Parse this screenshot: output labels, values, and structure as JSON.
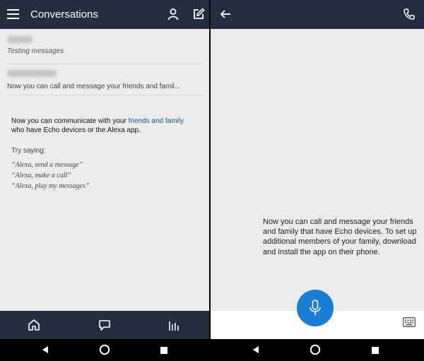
{
  "left": {
    "header": {
      "title": "Conversations"
    },
    "conversations": [
      {
        "subtitle": "Testing messages"
      },
      {
        "subtitle": "Now you can call and message your friends and famil..."
      }
    ],
    "info": {
      "line_start": "Now you can communicate with your ",
      "link": "friends and family",
      "line_end": "who have Echo devices or the Alexa app."
    },
    "try_label": "Try saying:",
    "phrases": [
      "“Alexa, send a message”",
      "“Alexa, make a call”",
      "“Alexa, play my messages”"
    ]
  },
  "right": {
    "message": "Now you can call and message your friends and family that have Echo devices. To set up additional members of your family, download and install the app on their phone."
  },
  "colors": {
    "header": "#232f3e",
    "accent": "#1a7ed4",
    "link": "#0f5aa6"
  },
  "icons": [
    "menu-icon",
    "person-icon",
    "compose-icon",
    "back-arrow-icon",
    "phone-icon",
    "home-icon",
    "chat-icon",
    "equalizer-icon",
    "microphone-icon",
    "keyboard-icon",
    "android-back-icon",
    "android-home-icon",
    "android-recents-icon"
  ]
}
